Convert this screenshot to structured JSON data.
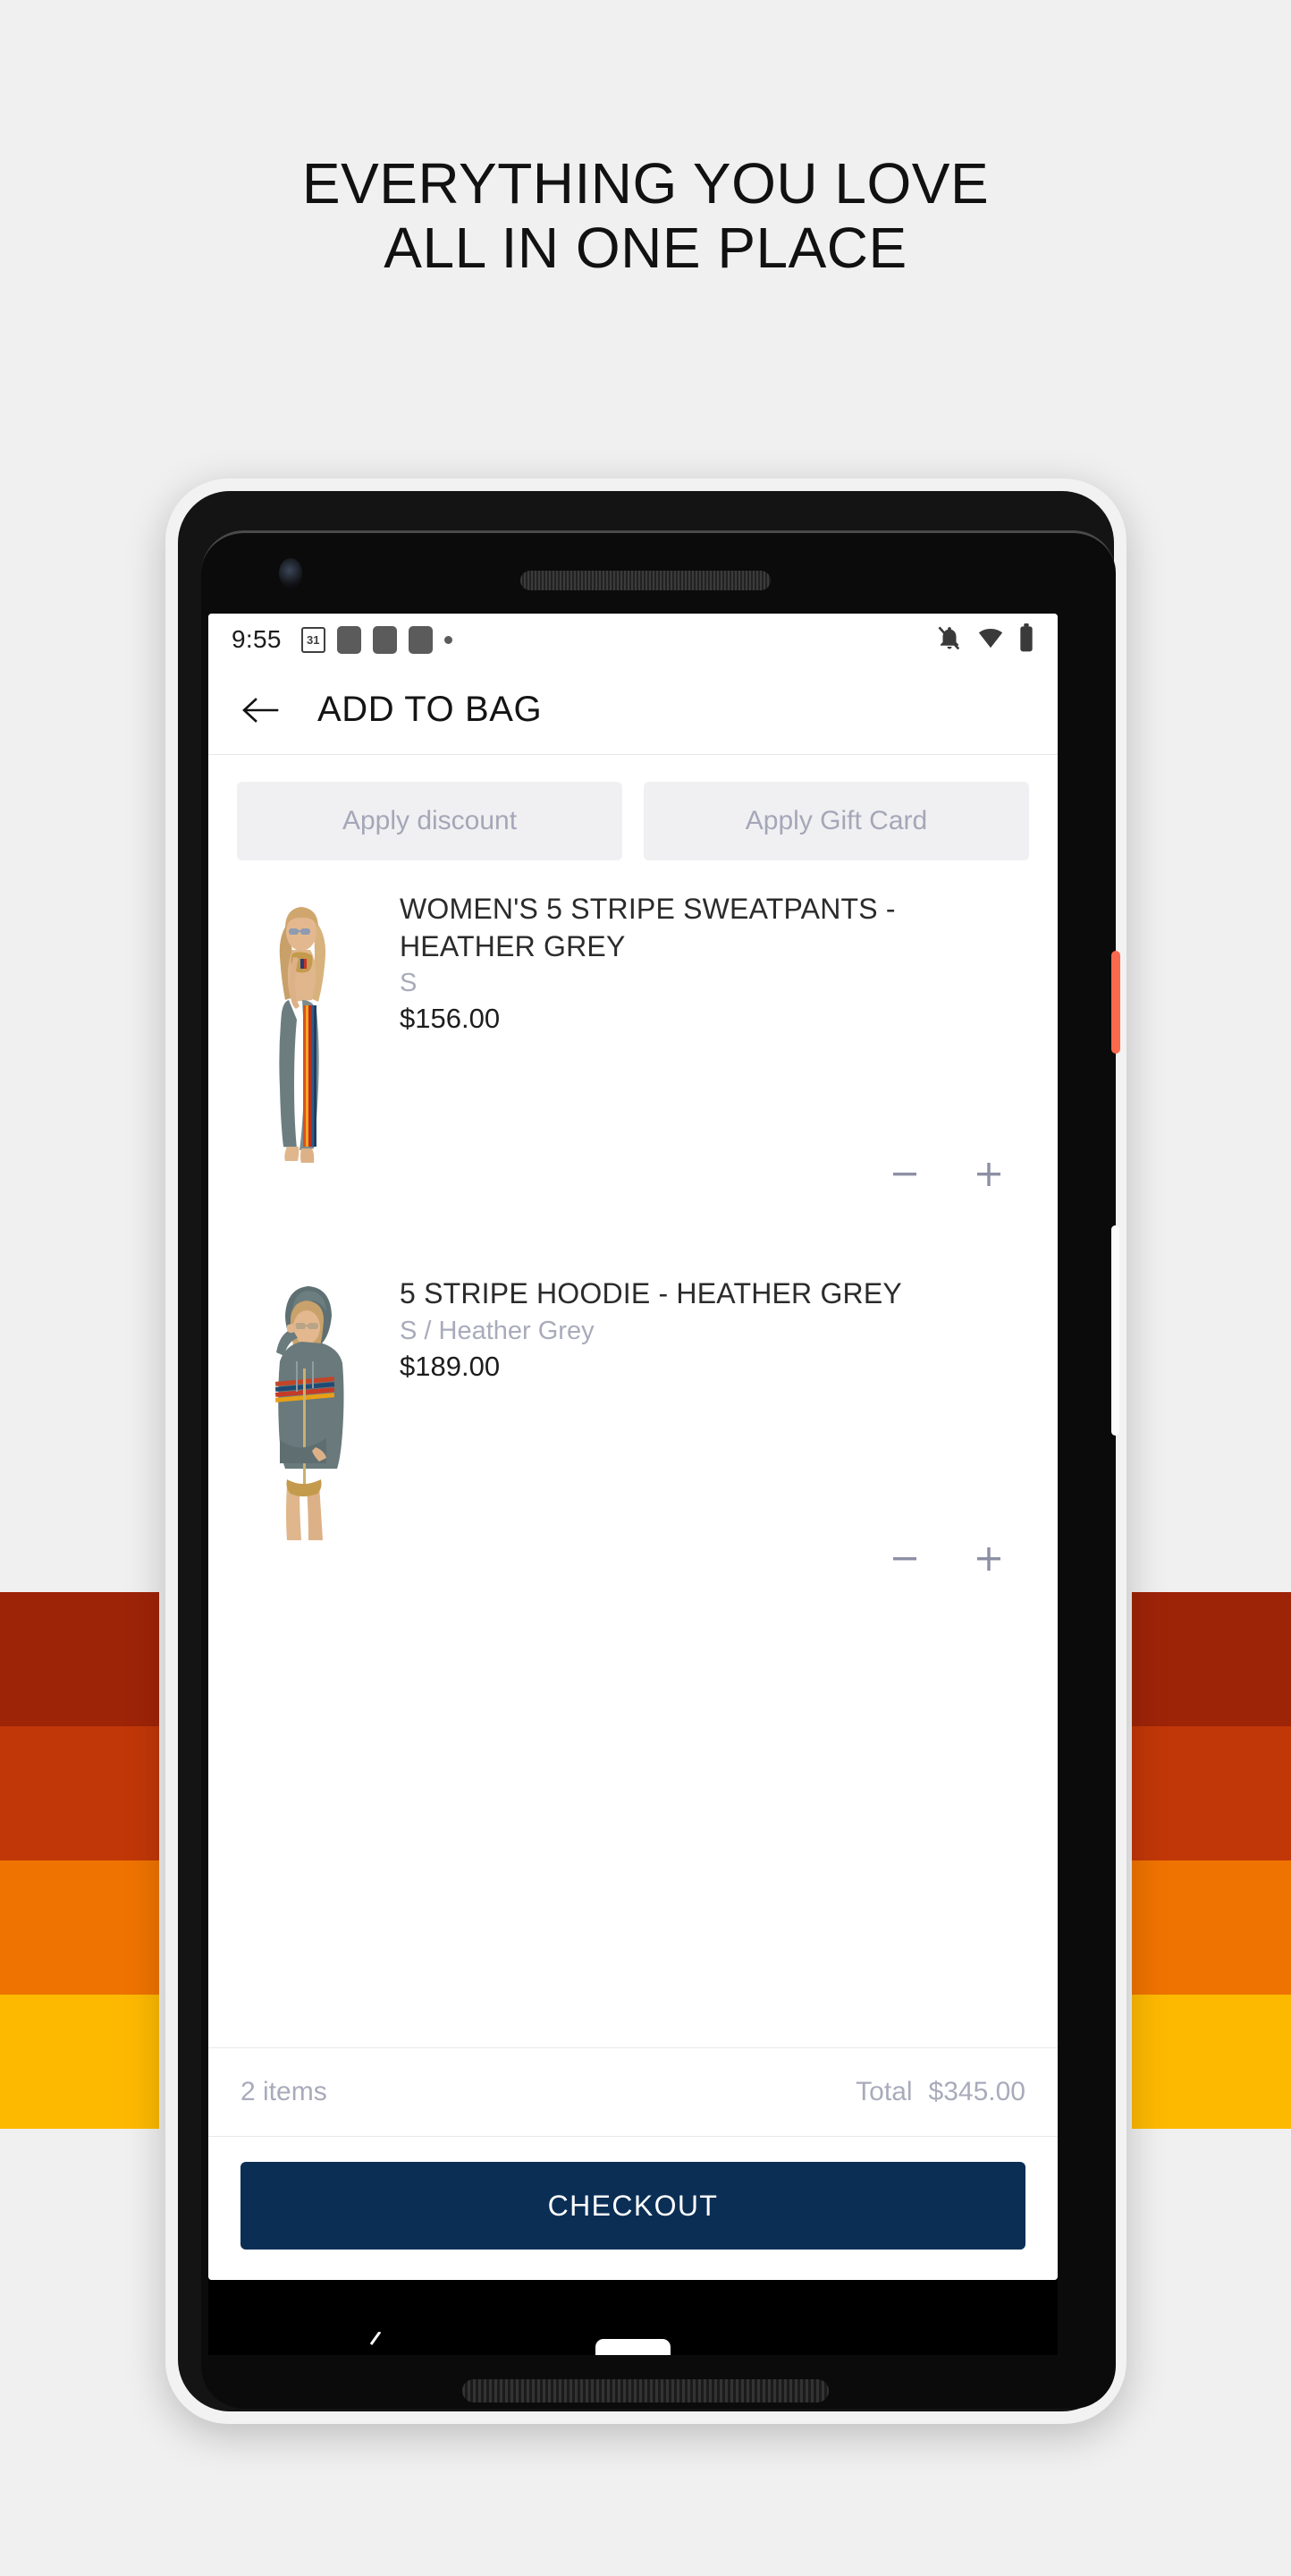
{
  "hero": {
    "headline_line1": "EVERYTHING YOU LOVE",
    "headline_line2": "ALL IN ONE PLACE"
  },
  "decor": {
    "stripe_colors": [
      "#9e2408",
      "#c13708",
      "#ef7300",
      "#fdb900"
    ],
    "power_button_color": "#f96a4d",
    "volume_button_color": "#fbfbfb"
  },
  "statusbar": {
    "time": "9:55",
    "calendar_day": "31",
    "icons": [
      "calendar-icon",
      "app-icon",
      "app-icon",
      "app-icon",
      "dot-icon",
      "notifications-off-icon",
      "wifi-icon",
      "battery-icon"
    ]
  },
  "appbar": {
    "back_label": "back-arrow-icon",
    "title": "ADD TO BAG"
  },
  "promos": {
    "discount_label": "Apply discount",
    "gift_card_label": "Apply Gift Card"
  },
  "cart": {
    "items": [
      {
        "title": "WOMEN'S 5 STRIPE SWEATPANTS - HEATHER GREY",
        "variant": "S",
        "price": "$156.00",
        "decrement_label": "−",
        "increment_label": "+"
      },
      {
        "title": "5 STRIPE HOODIE - HEATHER GREY",
        "variant": "S / Heather Grey",
        "price": "$189.00",
        "decrement_label": "−",
        "increment_label": "+"
      }
    ]
  },
  "footer": {
    "item_count": "2 items",
    "total_label": "Total",
    "total_value": "$345.00",
    "checkout_label": "CHECKOUT"
  },
  "theme": {
    "checkout_bg": "#0b2e55",
    "muted_text": "#a9abbb",
    "promo_bg": "#f0f0f2",
    "page_bg": "#f0f0f0"
  }
}
